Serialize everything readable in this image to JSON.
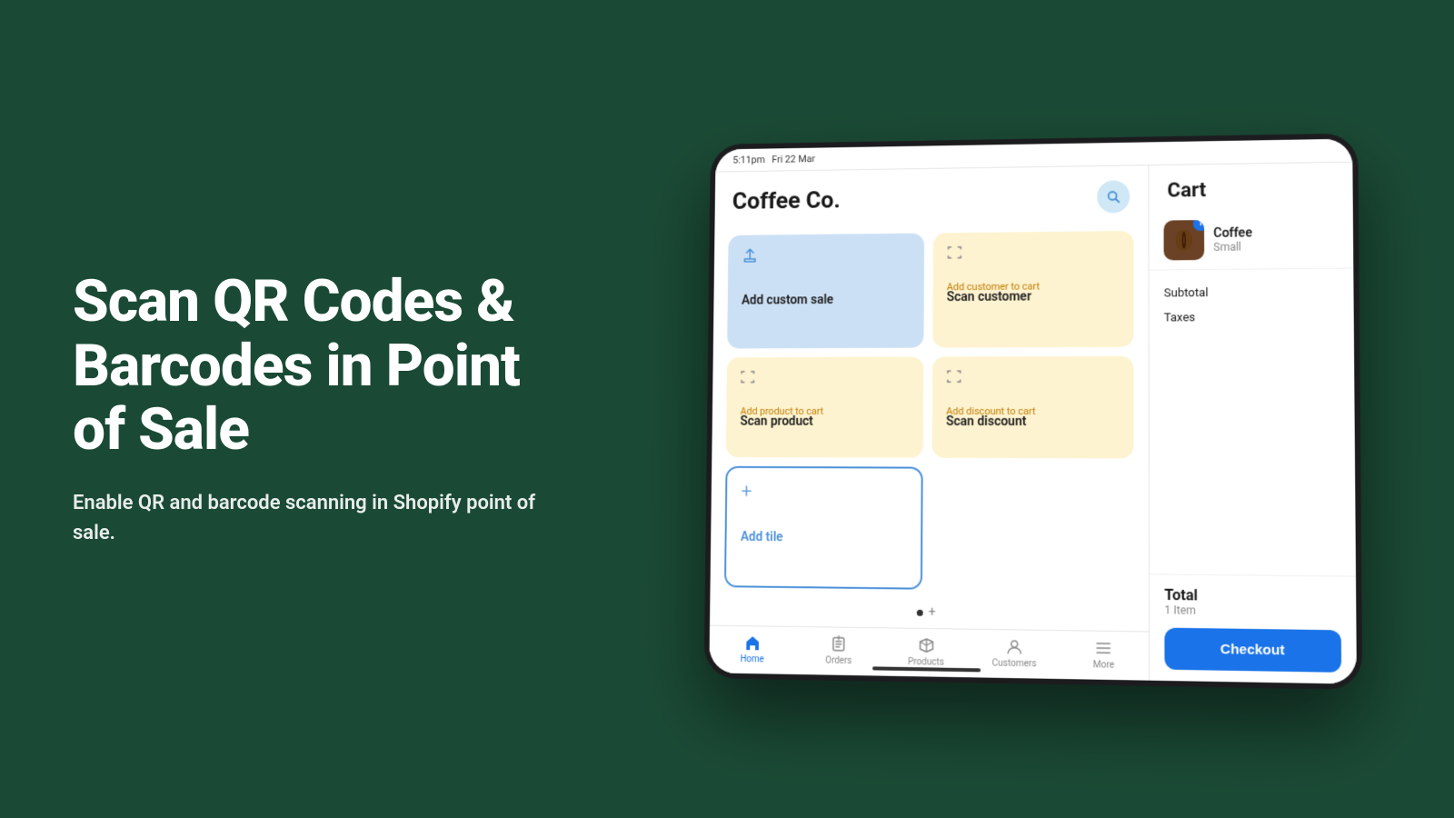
{
  "left": {
    "hero_title": "Scan QR Codes & Barcodes in Point of Sale",
    "hero_subtitle": "Enable QR and barcode scanning in Shopify point of sale."
  },
  "device": {
    "status_bar": {
      "time": "5:11pm",
      "date": "Fri 22 Mar"
    },
    "pos": {
      "title": "Coffee Co.",
      "search_icon": "search",
      "tiles": [
        {
          "id": "custom-sale",
          "label": "Add custom sale",
          "sublabel": "",
          "type": "blue",
          "icon": "share"
        },
        {
          "id": "scan-customer",
          "label": "Scan customer",
          "sublabel": "Add customer to cart",
          "type": "yellow",
          "icon": "scan"
        },
        {
          "id": "scan-product",
          "label": "Scan product",
          "sublabel": "Add product to cart",
          "type": "yellow",
          "icon": "scan"
        },
        {
          "id": "scan-discount",
          "label": "Scan discount",
          "sublabel": "Add discount to cart",
          "type": "yellow",
          "icon": "scan"
        },
        {
          "id": "add-tile",
          "label": "Add tile",
          "sublabel": "",
          "type": "outline",
          "icon": "plus"
        }
      ],
      "nav_items": [
        {
          "id": "home",
          "label": "Home",
          "icon": "⌂",
          "active": true
        },
        {
          "id": "orders",
          "label": "Orders",
          "icon": "↑",
          "active": false
        },
        {
          "id": "products",
          "label": "Products",
          "icon": "🏷",
          "active": false
        },
        {
          "id": "customers",
          "label": "Customers",
          "icon": "👤",
          "active": false
        },
        {
          "id": "more",
          "label": "More",
          "icon": "≡",
          "active": false
        }
      ]
    },
    "cart": {
      "title": "Cart",
      "item": {
        "name": "Coffee",
        "variant": "Small",
        "badge": "1"
      },
      "subtotal_label": "Subtotal",
      "taxes_label": "Taxes",
      "total_label": "Total",
      "total_count": "1 Item",
      "checkout_label": "Checkout"
    }
  }
}
